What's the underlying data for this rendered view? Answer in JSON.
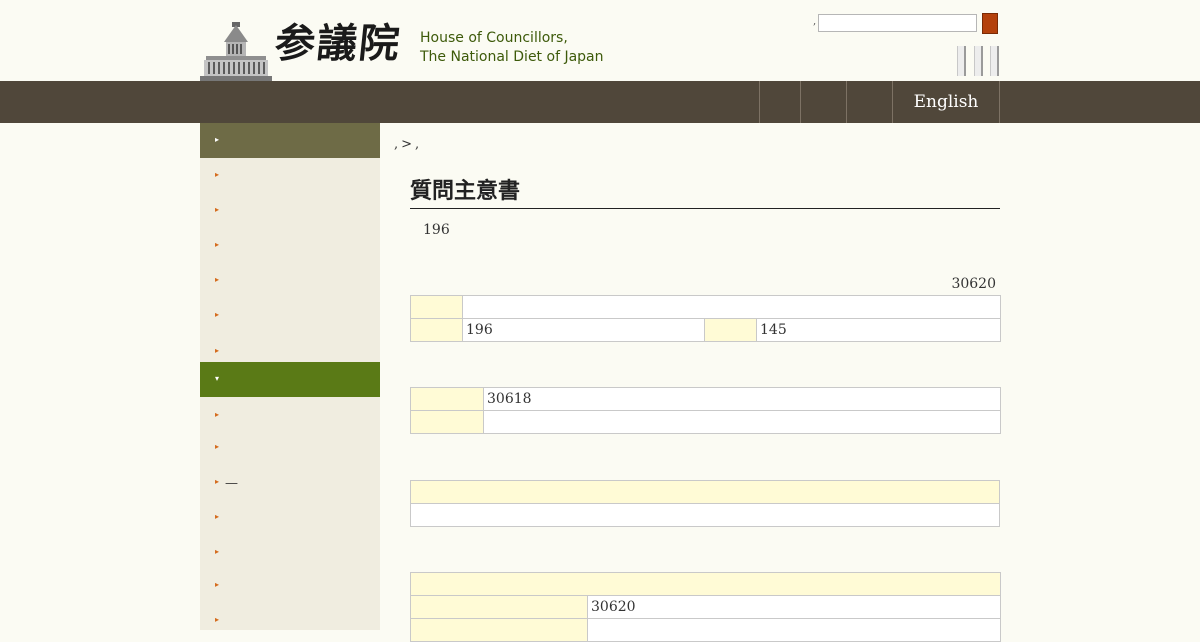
{
  "header": {
    "logo_kanji": "参議院",
    "logo_en_line1": "House of Councillors,",
    "logo_en_line2": "The National Diet of Japan",
    "search": {
      "dot": ",",
      "value": "",
      "placeholder": ""
    }
  },
  "navbar": {
    "items": [
      "",
      "",
      "",
      "English"
    ]
  },
  "sidebar": {
    "arrow_right": "▸",
    "arrow_down": "▾",
    "dash_item": "—"
  },
  "breadcrumb": {
    "left": ",",
    "sep": ">",
    "right": ","
  },
  "main": {
    "title": "質問主意書",
    "session": "196",
    "date_right": "30620",
    "table1": {
      "row2_val1": "196",
      "row2_val2": "145"
    },
    "table2": {
      "row1_val": "30618"
    },
    "table4": {
      "row2_val": "30620"
    }
  },
  "colors": {
    "background": "#fbfbf3",
    "navbar": "#50473a",
    "sidebar": "#f0ede0",
    "sidebar_active_top": "#6e6b46",
    "sidebar_active_open": "#5a7a16",
    "label_cell": "#fffbd6",
    "search_button": "#b4410c"
  }
}
